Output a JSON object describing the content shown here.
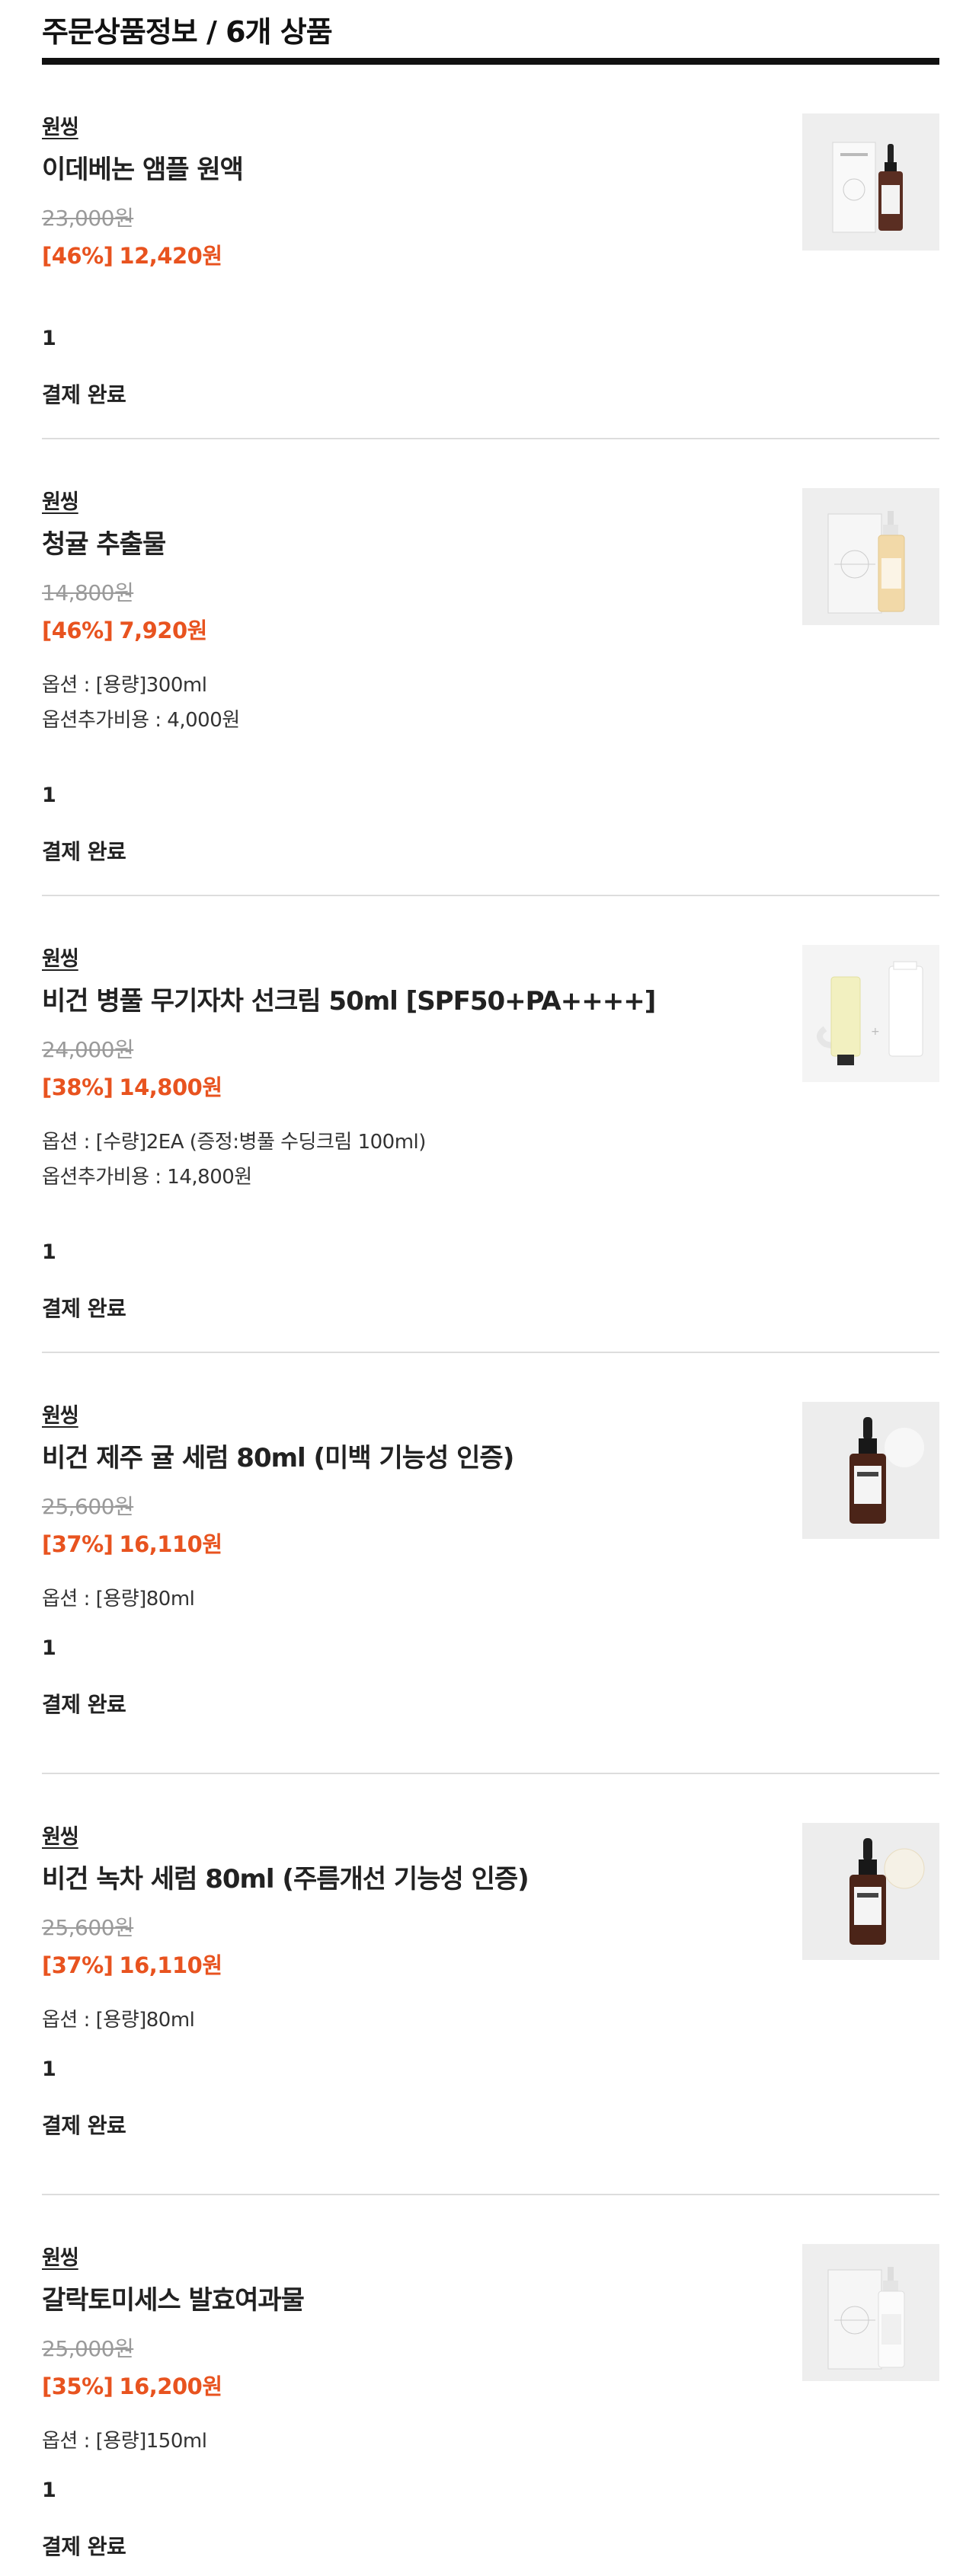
{
  "section": {
    "title": "주문상품정보 / 6개 상품"
  },
  "items": [
    {
      "brand": "원씽",
      "name": "이데베논 앰플 원액",
      "original_price": "23,000원",
      "discount": "[46%]",
      "sale_price": "12,420원",
      "option": "",
      "option_extra": "",
      "quantity": "1",
      "status": "결제 완료",
      "thumb_icon": "dropper-bottle-with-box-icon"
    },
    {
      "brand": "원씽",
      "name": "청귤 추출물",
      "original_price": "14,800원",
      "discount": "[46%]",
      "sale_price": "7,920원",
      "option": "옵션 : [용량]300ml",
      "option_extra": "옵션추가비용 : 4,000원",
      "quantity": "1",
      "status": "결제 완료",
      "thumb_icon": "pump-bottle-with-box-icon"
    },
    {
      "brand": "원씽",
      "name": "비건 병풀 무기자차 선크림 50ml [SPF50+PA++++]",
      "original_price": "24,000원",
      "discount": "[38%]",
      "sale_price": "14,800원",
      "option": "옵션 : [수량]2EA (증정:병풀 수딩크림 100ml)",
      "option_extra": "옵션추가비용 : 14,800원",
      "quantity": "1",
      "status": "결제 완료",
      "thumb_icon": "cream-tubes-icon"
    },
    {
      "brand": "원씽",
      "name": "비건 제주 귤 세럼 80ml (미백 기능성 인증)",
      "original_price": "25,600원",
      "discount": "[37%]",
      "sale_price": "16,110원",
      "option": "옵션 : [용량]80ml",
      "option_extra": "",
      "quantity": "1",
      "status": "결제 완료",
      "thumb_icon": "amber-serum-bottle-icon"
    },
    {
      "brand": "원씽",
      "name": "비건 녹차 세럼 80ml (주름개선 기능성 인증)",
      "original_price": "25,600원",
      "discount": "[37%]",
      "sale_price": "16,110원",
      "option": "옵션 : [용량]80ml",
      "option_extra": "",
      "quantity": "1",
      "status": "결제 완료",
      "thumb_icon": "amber-serum-bottle-icon"
    },
    {
      "brand": "원씽",
      "name": "갈락토미세스 발효여과물",
      "original_price": "25,000원",
      "discount": "[35%]",
      "sale_price": "16,200원",
      "option": "옵션 : [용량]150ml",
      "option_extra": "",
      "quantity": "1",
      "status": "결제 완료",
      "thumb_icon": "pump-bottle-with-box-icon"
    }
  ]
}
